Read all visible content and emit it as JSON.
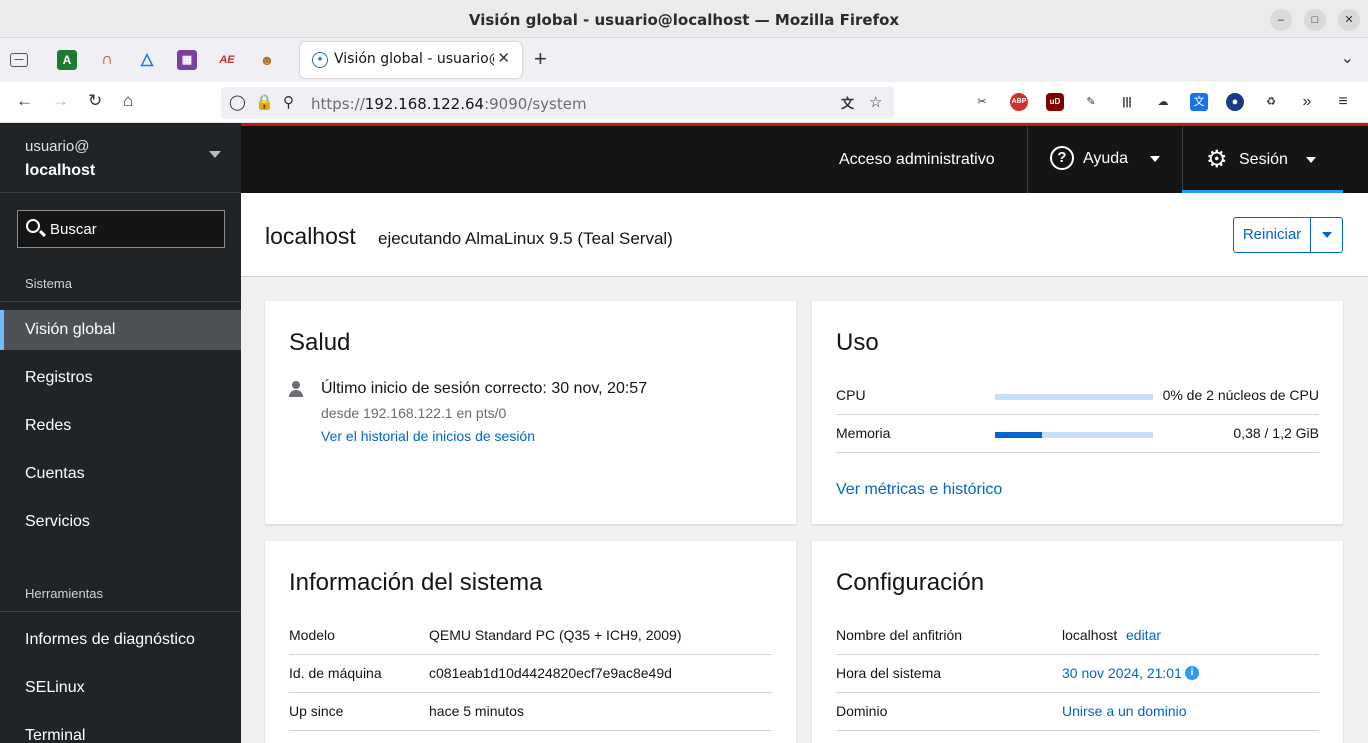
{
  "browser": {
    "window_title": "Visión global - usuario@localhost — Mozilla Firefox",
    "tab_title": "Visión global - usuario@localhost",
    "url_host": "192.168.122.64",
    "url_prefix": "https://",
    "url_suffix": ":9090/system",
    "pinned": [
      "A",
      "ABP",
      "uD"
    ]
  },
  "sidebar": {
    "user": "usuario@",
    "host": "localhost",
    "search_placeholder": "Buscar",
    "section_system": "Sistema",
    "items": [
      "Visión global",
      "Registros",
      "Redes",
      "Cuentas",
      "Servicios"
    ],
    "section_tools": "Herramientas",
    "tools": [
      "Informes de diagnóstico",
      "SELinux",
      "Terminal"
    ]
  },
  "topbar": {
    "admin": "Acceso administrativo",
    "help": "Ayuda",
    "session": "Sesión"
  },
  "header": {
    "host": "localhost",
    "os": "ejecutando AlmaLinux 9.5 (Teal Serval)",
    "restart": "Reiniciar"
  },
  "health": {
    "title": "Salud",
    "last_login": "Último inicio de sesión correcto: 30 nov, 20:57",
    "from": "desde 192.168.122.1 en pts/0",
    "history_link": "Ver el historial de inicios de sesión"
  },
  "usage": {
    "title": "Uso",
    "cpu_label": "CPU",
    "cpu_value": "0% de 2 núcleos de CPU",
    "cpu_fraction": 0.0,
    "mem_label": "Memoria",
    "mem_value": "0,38 / 1,2 GiB",
    "mem_fraction": 0.3,
    "metrics_link": "Ver métricas e histórico"
  },
  "sysinfo": {
    "title": "Información del sistema",
    "rows": [
      {
        "k": "Modelo",
        "v": "QEMU Standard PC (Q35 + ICH9, 2009)"
      },
      {
        "k": "Id. de máquina",
        "v": "c081eab1d10d4424820ecf7e9ac8e49d"
      },
      {
        "k": "Up since",
        "v": "hace 5 minutos"
      }
    ]
  },
  "config": {
    "title": "Configuración",
    "hostname_label": "Nombre del anfitrión",
    "hostname_value": "localhost",
    "hostname_edit": "editar",
    "time_label": "Hora del sistema",
    "time_value": "30 nov 2024, 21:01",
    "domain_label": "Dominio",
    "domain_value": "Unirse a un dominio"
  },
  "colors": {
    "accent": "#0066cc",
    "sidebar_bg": "#212427",
    "topbar_bg": "#151515",
    "topbar_border": "#c9190b"
  }
}
